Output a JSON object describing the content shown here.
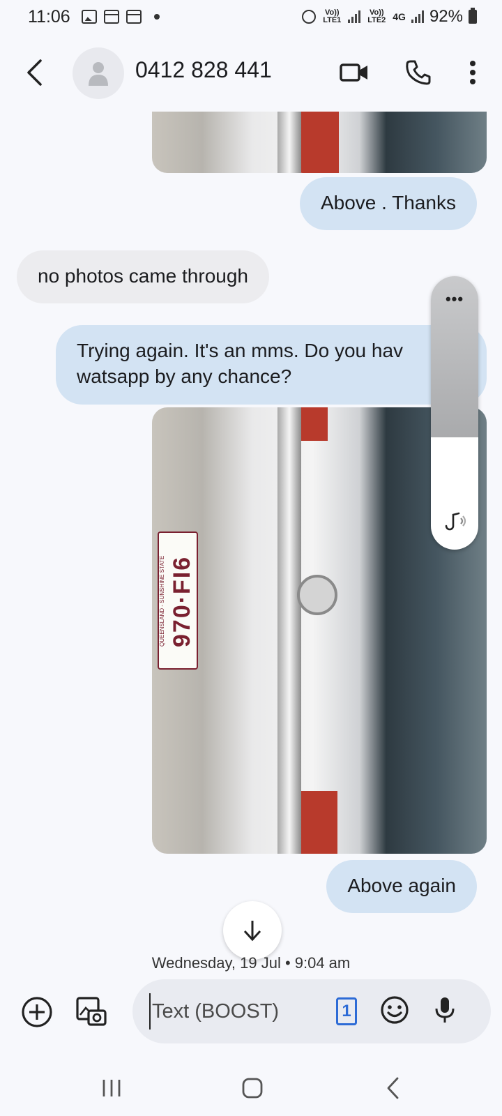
{
  "status_bar": {
    "time": "11:06",
    "sim1_label": "Vo)) LTE1",
    "sim2_label": "Vo)) LTE2",
    "network": "4G",
    "battery": "92%"
  },
  "header": {
    "contact": "0412 828 441",
    "icons": [
      "back-arrow-icon",
      "avatar-icon",
      "video-call-icon",
      "phone-icon",
      "more-vert-icon"
    ]
  },
  "messages": [
    {
      "type": "image",
      "direction": "out"
    },
    {
      "type": "text",
      "direction": "out",
      "text": "Above . Thanks"
    },
    {
      "type": "text",
      "direction": "in",
      "text": "no photos came through"
    },
    {
      "type": "text",
      "direction": "out",
      "line1": "Trying again. It's an mms. Do you hav",
      "line2": "watsapp by any chance?"
    },
    {
      "type": "image",
      "direction": "out",
      "plate_number": "970·FI6",
      "plate_state": "QUEENSLAND - SUNSHINE STATE"
    },
    {
      "type": "text",
      "direction": "out",
      "text": "Above again"
    }
  ],
  "timestamp": "Wednesday, 19 Jul • 9:04 am",
  "composer": {
    "placeholder": "Text (BOOST)",
    "sim_badge": "1"
  },
  "volume_panel": {
    "more_label": "•••",
    "level": 0.41
  },
  "colors": {
    "outgoing_bubble": "#d3e3f3",
    "incoming_bubble": "#ececef",
    "background": "#f7f8fc",
    "sim_accent": "#2d6bd6"
  }
}
